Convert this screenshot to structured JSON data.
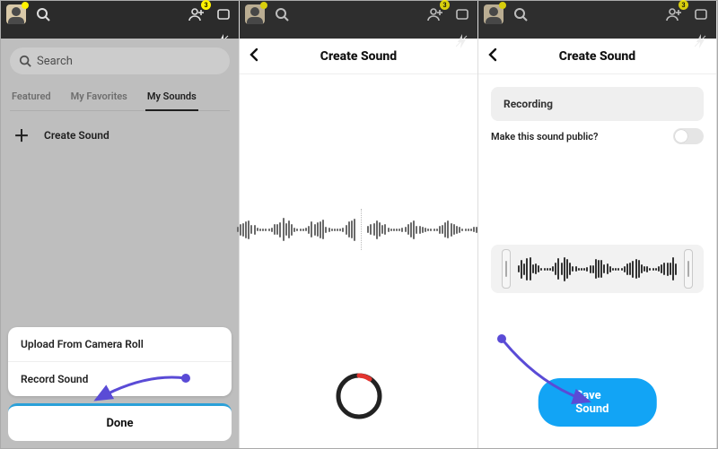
{
  "topbar": {
    "badge_count": "3"
  },
  "panel1": {
    "search_placeholder": "Search",
    "tabs": {
      "featured": "Featured",
      "favorites": "My Favorites",
      "mysounds": "My Sounds"
    },
    "create_label": "Create Sound",
    "sheet": {
      "upload": "Upload From Camera Roll",
      "record": "Record Sound"
    },
    "done": "Done"
  },
  "panel2": {
    "title": "Create Sound"
  },
  "panel3": {
    "title": "Create Sound",
    "section_label": "Recording",
    "public_label": "Make this sound public?",
    "save_label": "Save Sound"
  }
}
